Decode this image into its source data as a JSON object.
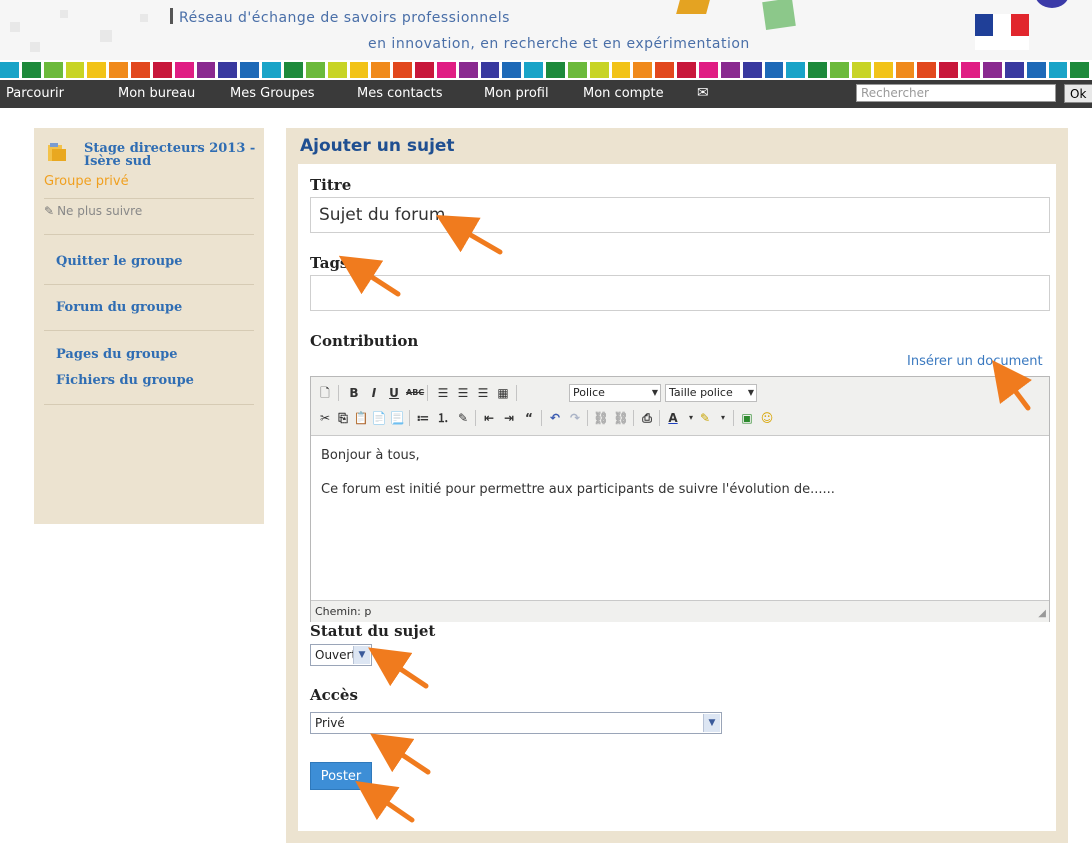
{
  "header": {
    "tagline_line1": "Réseau d'échange de savoirs professionnels",
    "tagline_line2": "en innovation, en recherche et en expérimentation",
    "colors": [
      "#1aa4c8",
      "#1e8a3c",
      "#6cba3c",
      "#c8d426",
      "#f2c318",
      "#f08a1c",
      "#e2481e",
      "#c8183c",
      "#e01e84",
      "#8a2a90",
      "#3a3aa0",
      "#1e6ab8",
      "#1aa4c8",
      "#1e8a3c",
      "#6cba3c",
      "#c8d426",
      "#f2c318",
      "#f08a1c",
      "#e2481e",
      "#c8183c",
      "#e01e84",
      "#8a2a90",
      "#3a3aa0",
      "#1e6ab8",
      "#1aa4c8",
      "#1e8a3c",
      "#6cba3c",
      "#c8d426",
      "#f2c318",
      "#f08a1c",
      "#e2481e",
      "#c8183c",
      "#e01e84",
      "#8a2a90",
      "#3a3aa0",
      "#1e6ab8",
      "#1aa4c8",
      "#1e8a3c",
      "#6cba3c",
      "#c8d426",
      "#f2c318",
      "#f08a1c",
      "#e2481e",
      "#c8183c",
      "#e01e84",
      "#8a2a90",
      "#3a3aa0",
      "#1e6ab8",
      "#1aa4c8",
      "#1e8a3c"
    ]
  },
  "nav": {
    "items": [
      "Parcourir",
      "Mon bureau",
      "Mes Groupes",
      "Mes contacts",
      "Mon profil",
      "Mon compte"
    ],
    "mail_icon": "envelope-icon",
    "search_placeholder": "Rechercher",
    "search_button": "Ok"
  },
  "sidebar": {
    "group_name": "Stage directeurs 2013 - Isère sud",
    "group_type": "Groupe privé",
    "unfollow": "Ne plus suivre",
    "links": [
      "Quitter le groupe",
      "Forum du groupe",
      "Pages du groupe",
      "Fichiers du groupe"
    ]
  },
  "form": {
    "title": "Ajouter un sujet",
    "title_label": "Titre",
    "title_value": "Sujet du forum",
    "tags_label": "Tags",
    "tags_value": "",
    "contribution_label": "Contribution",
    "insert_document": "Insérer un document",
    "editor": {
      "font_select": "Police",
      "size_select": "Taille police",
      "paragraph1": "Bonjour à tous,",
      "paragraph2": "Ce forum est initié pour permettre aux participants de suivre l'évolution de......",
      "path_label": "Chemin: p"
    },
    "status_label": "Statut du sujet",
    "status_value": "Ouvert",
    "access_label": "Accès",
    "access_value": "Privé",
    "submit": "Poster"
  },
  "accent_colors": {
    "arrow": "#f07b1e",
    "link": "#2f6db3",
    "panel_bg": "#ece3d0",
    "nav_bg": "#3a3a3a"
  }
}
